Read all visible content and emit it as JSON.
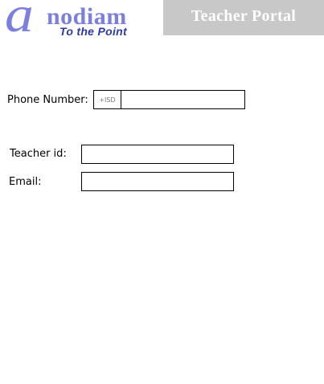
{
  "logo": {
    "letter": "a",
    "word": "nodiam",
    "tagline": "To the Point"
  },
  "header": {
    "portal_title": "Teacher Portal"
  },
  "form": {
    "phone_label": "Phone Number:",
    "isd_placeholder": "+ISD",
    "phone_value": "",
    "teacher_id_label": "Teacher id:",
    "teacher_id_value": "",
    "email_label": "Email:",
    "email_value": ""
  },
  "colors": {
    "logo_primary": "#7b7fe0",
    "logo_tagline": "#2c3aa6",
    "banner_bg": "#c8c8c8",
    "banner_text": "#ffffff"
  }
}
